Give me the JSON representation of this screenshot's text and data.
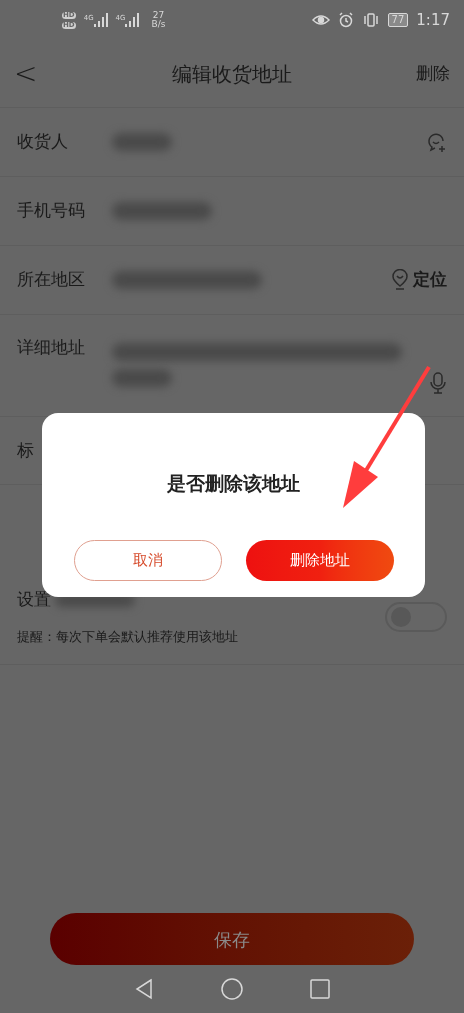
{
  "status_bar": {
    "hd_badges": [
      "HD",
      "HD"
    ],
    "networks": [
      "4G",
      "4G"
    ],
    "speed": [
      "27",
      "B/s"
    ],
    "battery": "77",
    "time": "1:17"
  },
  "header": {
    "back": "<",
    "title": "编辑收货地址",
    "action": "删除"
  },
  "form": {
    "rows": [
      {
        "kind": "contact",
        "label": "收货人"
      },
      {
        "kind": "plain",
        "label": "手机号码"
      },
      {
        "kind": "locate",
        "label": "所在地区",
        "action": "定位"
      },
      {
        "kind": "voice",
        "label": "详细地址"
      },
      {
        "kind": "tags",
        "label": "标"
      }
    ],
    "default": {
      "label": "设置",
      "hint": "提醒：每次下单会默认推荐使用该地址",
      "on": false
    }
  },
  "save_button": "保存",
  "dialog": {
    "title": "是否删除该地址",
    "cancel": "取消",
    "confirm": "删除地址"
  }
}
